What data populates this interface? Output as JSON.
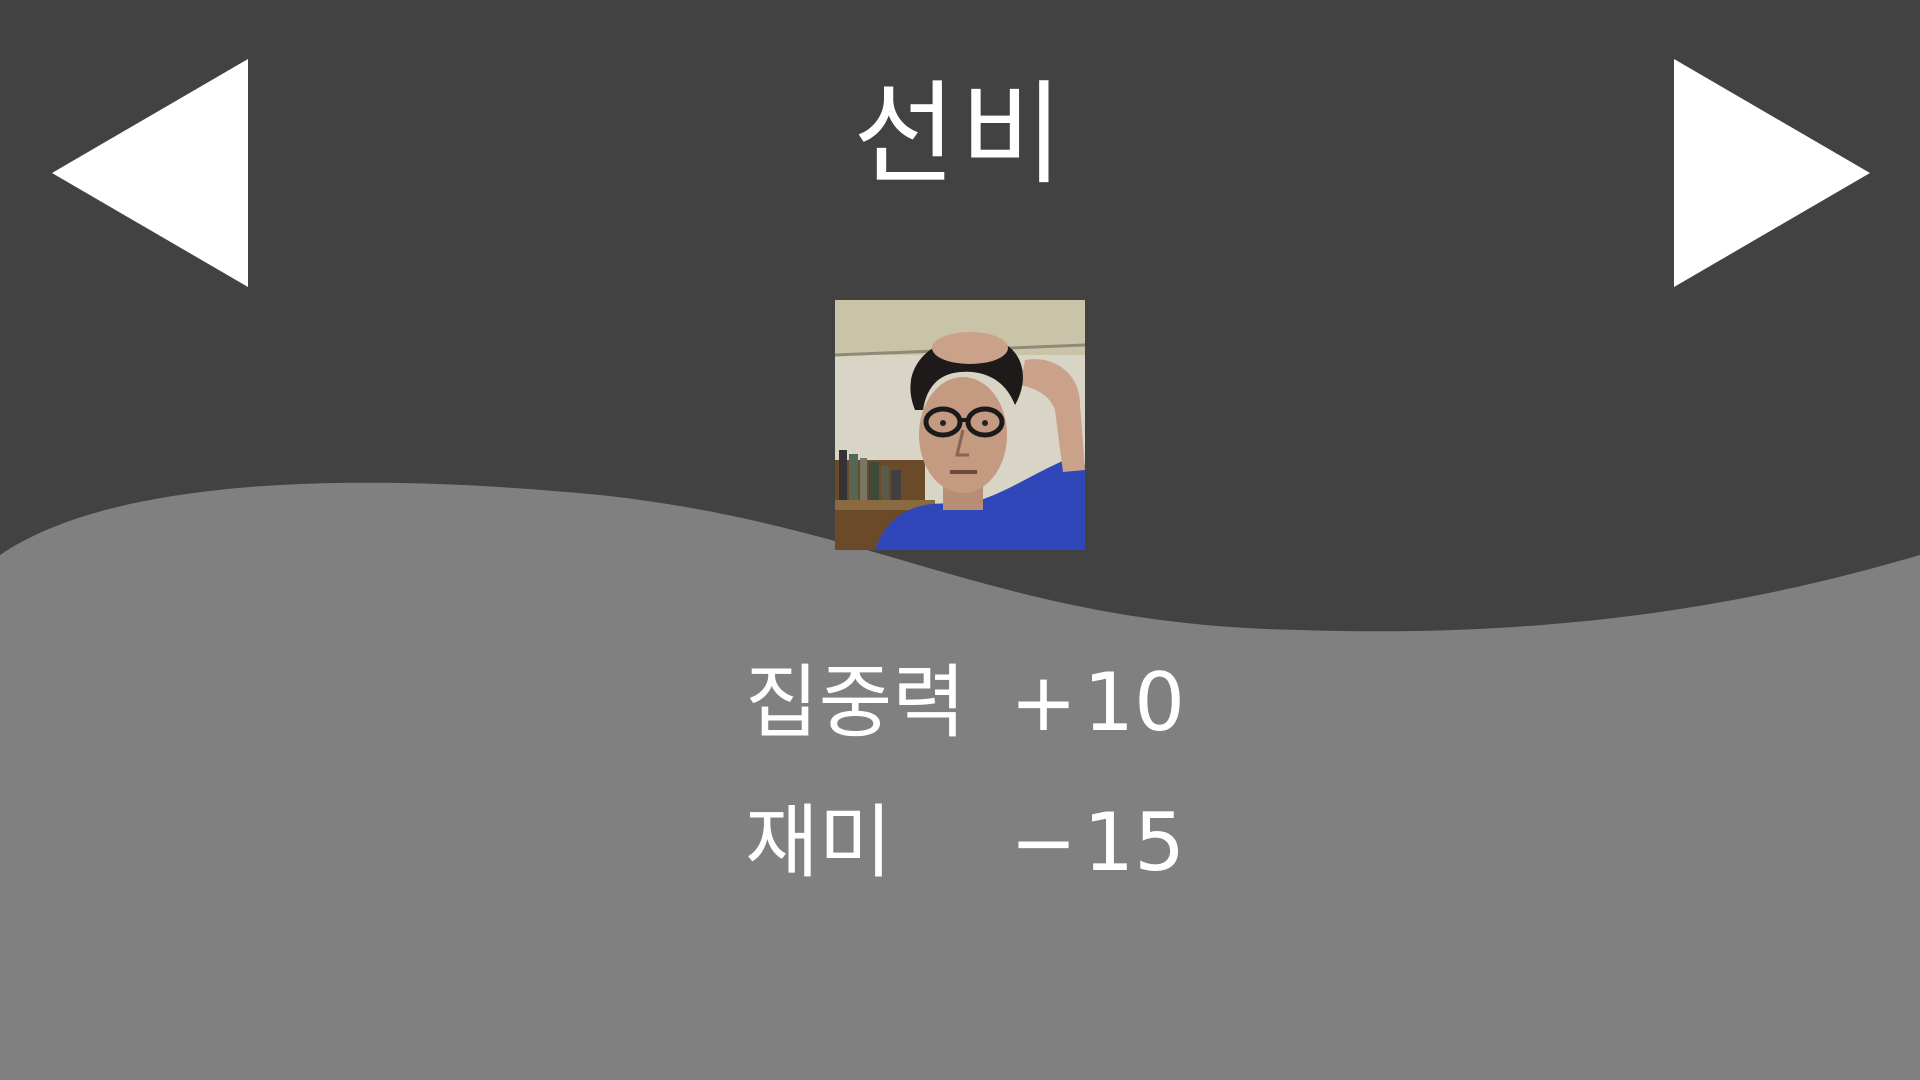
{
  "colors": {
    "top_background": "#424242",
    "bottom_background": "#808080",
    "text": "#ffffff",
    "arrow": "#ffffff"
  },
  "navigation": {
    "prev_icon": "triangle-left-icon",
    "next_icon": "triangle-right-icon"
  },
  "character": {
    "name": "선비",
    "portrait": "portrait-photo"
  },
  "stats": [
    {
      "name": "집중력",
      "sign": "+",
      "value": "10"
    },
    {
      "name": "재미",
      "sign": "−",
      "value": "15"
    }
  ]
}
